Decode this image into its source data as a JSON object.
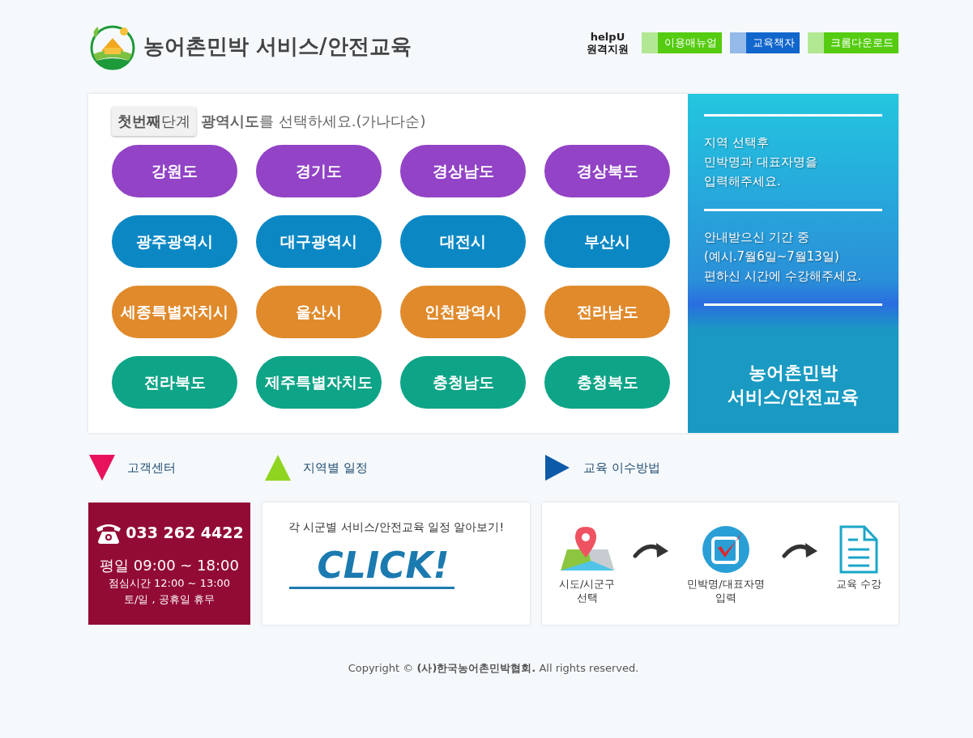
{
  "header": {
    "title": "농어촌민박 서비스/안전교육",
    "helpu": {
      "brand": "helpU",
      "label": "원격지원"
    },
    "links": [
      {
        "label": "이용매뉴얼",
        "color": "#55cc11"
      },
      {
        "label": "교육책자",
        "color": "#1166cc"
      },
      {
        "label": "크롬다운로드",
        "color": "#55cc11"
      }
    ]
  },
  "step": {
    "badge": "**첫번째**단계",
    "instruction": "**광역시도**를 선택하세요.(가나다순)"
  },
  "regions": [
    {
      "label": "강원도",
      "color": "#9243c6"
    },
    {
      "label": "경기도",
      "color": "#9243c6"
    },
    {
      "label": "경상남도",
      "color": "#9243c6"
    },
    {
      "label": "경상북도",
      "color": "#9243c6"
    },
    {
      "label": "광주광역시",
      "color": "#0b88c4"
    },
    {
      "label": "대구광역시",
      "color": "#0b88c4"
    },
    {
      "label": "대전시",
      "color": "#0b88c4"
    },
    {
      "label": "부산시",
      "color": "#0b88c4"
    },
    {
      "label": "세종특별자치시",
      "color": "#e08a2c"
    },
    {
      "label": "울산시",
      "color": "#e08a2c"
    },
    {
      "label": "인천광역시",
      "color": "#e08a2c"
    },
    {
      "label": "전라남도",
      "color": "#e08a2c"
    },
    {
      "label": "전라북도",
      "color": "#0ea487"
    },
    {
      "label": "제주특별자치도",
      "color": "#0ea487"
    },
    {
      "label": "충청남도",
      "color": "#0ea487"
    },
    {
      "label": "충청북도",
      "color": "#0ea487"
    }
  ],
  "guide": {
    "paragraphs": [
      "지역 선택후\n민박명과 대표자명을\n입력해주세요.",
      "안내받으신 기간 중\n(예시.7월6일~7월13일)\n편하신 시간에 수강해주세요."
    ],
    "title": "농어촌민박\n서비스/안전교육"
  },
  "sections": [
    {
      "heading": "고객센터",
      "kind": "down",
      "color": "#e8125c"
    },
    {
      "heading": "지역별 일정",
      "kind": "up",
      "color": "#8fd421"
    },
    {
      "heading": "교육 이수방법",
      "kind": "right",
      "color": "#0d5aa8"
    }
  ],
  "contact": {
    "phone": "033 262 4422",
    "hours": "평일 09:00 ~ 18:00",
    "lunch": "점심시간 12:00 ~ 13:00",
    "closed": "토/일 , 공휴일 휴무"
  },
  "schedule": {
    "caption": "각 시군별 서비스/안전교육 일정 알아보기!",
    "link": "CLICK!"
  },
  "steps": [
    {
      "kind": "map",
      "label": "시도/시군구\n선택"
    },
    {
      "kind": "check",
      "label": "민박명/대표자명\n입력"
    },
    {
      "kind": "document",
      "label": "교육 수강"
    }
  ],
  "footer": {
    "copyright": "Copyright © **(사)한국농어촌민박협회.** All rights reserved."
  }
}
